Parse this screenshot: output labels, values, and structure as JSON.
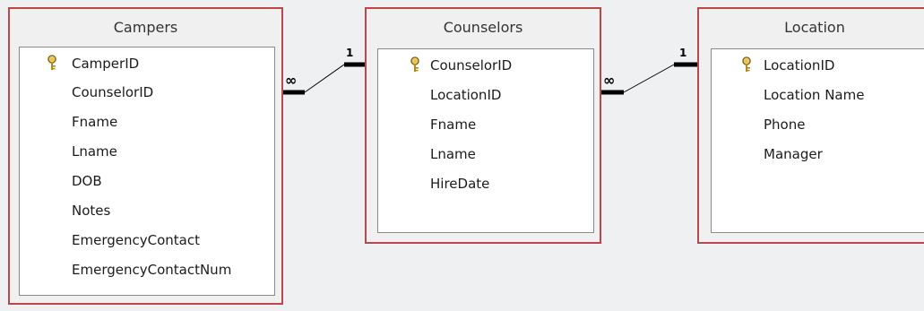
{
  "tables": {
    "campers": {
      "title": "Campers",
      "fields": [
        "CamperID",
        "CounselorID",
        "Fname",
        "Lname",
        "DOB",
        "Notes",
        "EmergencyContact",
        "EmergencyContactNum"
      ]
    },
    "counselors": {
      "title": "Counselors",
      "fields": [
        "CounselorID",
        "LocationID",
        "Fname",
        "Lname",
        "HireDate"
      ]
    },
    "location": {
      "title": "Location",
      "fields": [
        "LocationID",
        "Location Name",
        "Phone",
        "Manager"
      ]
    }
  },
  "relationships": [
    {
      "many_label": "∞",
      "one_label": "1"
    },
    {
      "many_label": "∞",
      "one_label": "1"
    }
  ],
  "icons": {
    "primary_key": "key-icon"
  },
  "colors": {
    "table_border": "#b8484c",
    "background": "#eef0f2"
  }
}
